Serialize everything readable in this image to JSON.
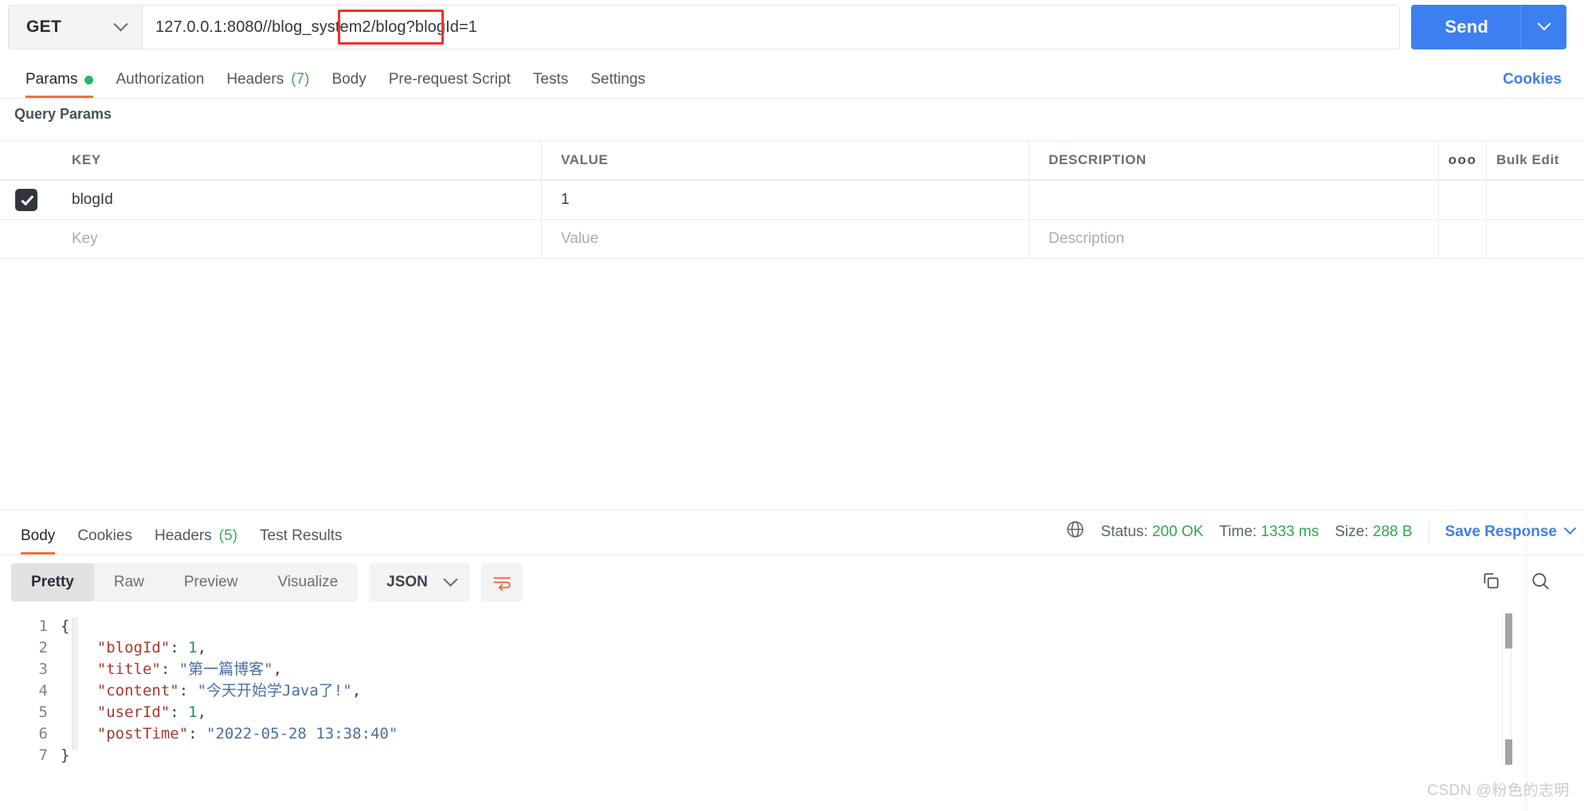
{
  "request": {
    "method": "GET",
    "method_icon": "chevron-down-icon",
    "url": "127.0.0.1:8080//blog_system2/blog?blogId=1",
    "url_annotation_text": "blogId=1",
    "annotation_color": "#f42f2f",
    "send_label": "Send",
    "send_color": "#3c7ff0",
    "tabs": [
      {
        "label": "Params",
        "badge": "dot",
        "active": true
      },
      {
        "label": "Authorization",
        "badge": "",
        "active": false
      },
      {
        "label": "Headers",
        "count": "(7)",
        "active": false
      },
      {
        "label": "Body",
        "badge": "",
        "active": false
      },
      {
        "label": "Pre-request Script",
        "badge": "",
        "active": false
      },
      {
        "label": "Tests",
        "badge": "",
        "active": false
      },
      {
        "label": "Settings",
        "badge": "",
        "active": false
      }
    ],
    "cookies_link": "Cookies"
  },
  "query_params": {
    "title": "Query Params",
    "columns": {
      "key": "KEY",
      "value": "VALUE",
      "description": "DESCRIPTION"
    },
    "menu_icon": "ooo",
    "bulk_edit": "Bulk Edit",
    "rows": [
      {
        "checked": true,
        "key": "blogId",
        "value": "1",
        "description": ""
      }
    ],
    "placeholder_row": {
      "key": "Key",
      "value": "Value",
      "description": "Description"
    }
  },
  "response": {
    "tabs": [
      {
        "label": "Body",
        "active": true
      },
      {
        "label": "Cookies",
        "active": false
      },
      {
        "label": "Headers",
        "count": "(5)",
        "active": false
      },
      {
        "label": "Test Results",
        "active": false
      }
    ],
    "globe_icon": "globe-icon",
    "status_label": "Status:",
    "status_value": "200 OK",
    "time_label": "Time:",
    "time_value": "1333 ms",
    "size_label": "Size:",
    "size_value": "288 B",
    "save_response": "Save Response",
    "status_color": "#2fa84f",
    "view_modes": [
      {
        "label": "Pretty",
        "active": true
      },
      {
        "label": "Raw",
        "active": false
      },
      {
        "label": "Preview",
        "active": false
      },
      {
        "label": "Visualize",
        "active": false
      }
    ],
    "format": "JSON",
    "wrap_icon": "word-wrap-icon",
    "copy_icon": "copy-icon",
    "search_icon": "search-icon",
    "line_numbers": [
      "1",
      "2",
      "3",
      "4",
      "5",
      "6",
      "7"
    ],
    "body_json": {
      "open_brace": "{",
      "close_brace": "}",
      "entries": [
        {
          "key": "\"blogId\"",
          "colon": ": ",
          "value": "1",
          "type": "number",
          "comma": ","
        },
        {
          "key": "\"title\"",
          "colon": ": ",
          "value": "\"第一篇博客\"",
          "type": "string",
          "comma": ","
        },
        {
          "key": "\"content\"",
          "colon": ": ",
          "value": "\"今天开始学Java了!\"",
          "type": "string",
          "comma": ","
        },
        {
          "key": "\"userId\"",
          "colon": ": ",
          "value": "1",
          "type": "number",
          "comma": ","
        },
        {
          "key": "\"postTime\"",
          "colon": ": ",
          "value": "\"2022-05-28 13:38:40\"",
          "type": "string",
          "comma": ""
        }
      ]
    }
  },
  "watermark": "CSDN @粉色的志明"
}
